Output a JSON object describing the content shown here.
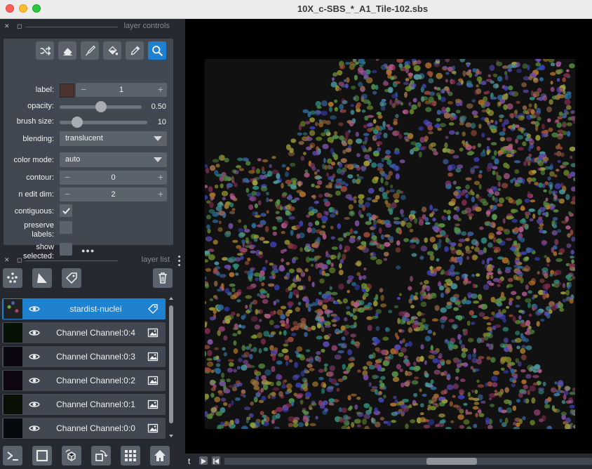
{
  "window": {
    "title": "10X_c-SBS_*_A1_Tile-102.sbs"
  },
  "layer_controls": {
    "header": "layer controls",
    "tools": [
      {
        "icon": "shuffle-icon",
        "active": false
      },
      {
        "icon": "eraser-icon",
        "active": false
      },
      {
        "icon": "paintbrush-icon",
        "active": false
      },
      {
        "icon": "fill-bucket-icon",
        "active": false
      },
      {
        "icon": "color-picker-icon",
        "active": false
      },
      {
        "icon": "zoom-icon",
        "active": true
      }
    ],
    "label": {
      "name": "label:",
      "value": "1",
      "color": "#4b342e"
    },
    "opacity": {
      "name": "opacity:",
      "value": "0.50",
      "fraction": 0.5
    },
    "brush_size": {
      "name": "brush size:",
      "value": "10",
      "fraction": 0.2
    },
    "blending": {
      "name": "blending:",
      "value": "translucent"
    },
    "color_mode": {
      "name": "color mode:",
      "value": "auto"
    },
    "contour": {
      "name": "contour:",
      "value": "0"
    },
    "n_edit_dim": {
      "name": "n edit dim:",
      "value": "2"
    },
    "contiguous": {
      "name": "contiguous:",
      "checked": true
    },
    "preserve_labels": {
      "line1": "preserve",
      "line2": "labels:",
      "checked": false
    },
    "show_selected": {
      "line1": "show",
      "line2": "selected:",
      "checked": false
    },
    "spinner_minus": "−",
    "spinner_plus": "+"
  },
  "layer_list": {
    "header": "layer list",
    "buttons": [
      "new-points-icon",
      "new-shapes-icon",
      "new-labels-icon",
      "delete-icon"
    ],
    "layers": [
      {
        "name": "stardist-nuclei",
        "type": "labels",
        "selected": true,
        "visible": true
      },
      {
        "name": "Channel Channel:0:4",
        "type": "image",
        "selected": false,
        "visible": true
      },
      {
        "name": "Channel Channel:0:3",
        "type": "image",
        "selected": false,
        "visible": true
      },
      {
        "name": "Channel Channel:0:2",
        "type": "image",
        "selected": false,
        "visible": true
      },
      {
        "name": "Channel Channel:0:1",
        "type": "image",
        "selected": false,
        "visible": true
      },
      {
        "name": "Channel Channel:0:0",
        "type": "image",
        "selected": false,
        "visible": true
      }
    ]
  },
  "bottom_buttons": [
    "console-icon",
    "ndisplay-square-icon",
    "roll-dims-icon",
    "transpose-icon",
    "grid-icon",
    "home-icon"
  ],
  "dims": {
    "axis_label": "t",
    "slider_fraction": 0.5
  },
  "colors": {
    "accent": "#1f82d1",
    "panel": "#414851",
    "background": "#262930",
    "button": "#5a626c"
  }
}
